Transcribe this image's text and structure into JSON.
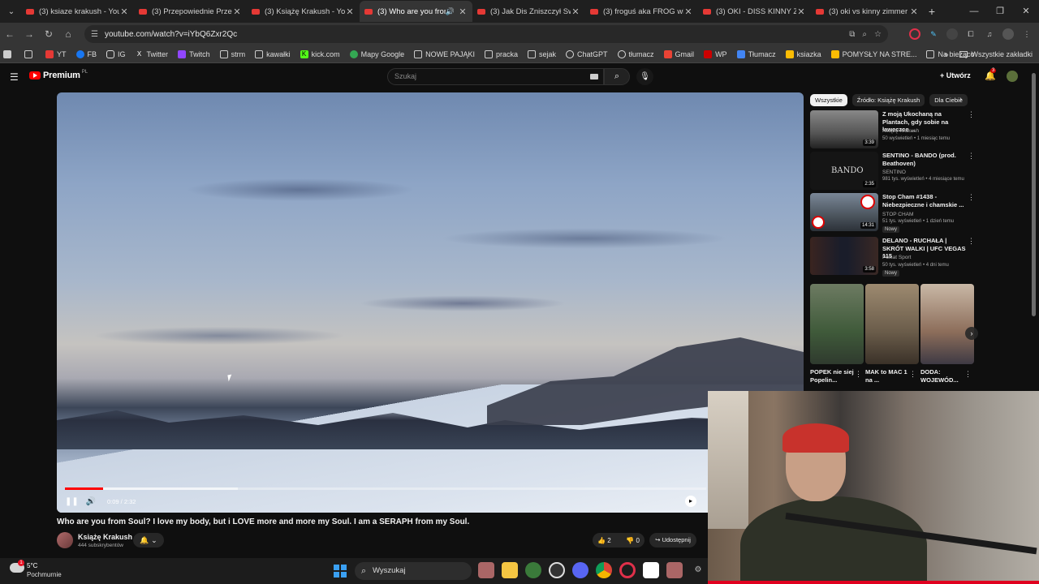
{
  "browser": {
    "tabs": [
      {
        "title": "(3) ksiaze krakush - YouTube",
        "active": false
      },
      {
        "title": "(3) Przepowiednie Prześw...",
        "active": false
      },
      {
        "title": "(3) Książę Krakush - YouTube",
        "active": false
      },
      {
        "title": "(3) Who are you from",
        "active": true
      },
      {
        "title": "(3) Jak Dis Zniszczył Swoje...",
        "active": false
      },
      {
        "title": "(3) froguś aka FROG wbije...",
        "active": false
      },
      {
        "title": "(3) OKI - DISS KINNY ZIMA...",
        "active": false
      },
      {
        "title": "(3) oki vs kinny zimmer -",
        "active": false
      }
    ],
    "url": "youtube.com/watch?v=iYbQ6Zxr2Qc",
    "bookmarks": [
      "YT",
      "FB",
      "IG",
      "Twitter",
      "Twitch",
      "strm",
      "kawałki",
      "kick.com",
      "Mapy Google",
      "NOWE PAJĄKI",
      "pracka",
      "sejak",
      "ChatGPT",
      "tłumacz",
      "Gmail",
      "WP",
      "Tłumacz",
      "ksiazka",
      "POMYSŁY NA STRE...",
      "Na bieżąco"
    ],
    "bookmarks_all": "Wszystkie zakładki"
  },
  "youtube": {
    "logo": "Premium",
    "logo_country": "PL",
    "search_placeholder": "Szukaj",
    "create_label": "Utwórz",
    "notif_count": "3",
    "video": {
      "title": "Who are you from Soul? I love my body, but i LOVE more and more my Soul. I am a SERAPH from my Soul.",
      "time": "0:09 / 2:32",
      "progress_played": 0.059,
      "progress_loaded": 0.27,
      "channel": "Książę Krakush",
      "subscribers": "444 subskrybentów",
      "likes": "2",
      "dislikes": "0",
      "share": "Udostępnij"
    },
    "chips": [
      "Wszystkie",
      "Źródło: Książę Krakush",
      "Dla Ciebie"
    ],
    "recommended": [
      {
        "title": "Z moją Ukochaną na Plantach, gdy sobie na ławeczce ...",
        "channel": "Książę Krakush",
        "meta": "50 wyświetleń • 1 miesiąc temu",
        "duration": "3:39",
        "badge": ""
      },
      {
        "title": "SENTINO - BANDO (prod. Beathoven)",
        "channel": "SENTINO",
        "meta": "981 tys. wyświetleń • 4 miesiące temu",
        "duration": "2:35",
        "badge": ""
      },
      {
        "title": "Stop Cham #1438 - Niebezpieczne i chamskie ...",
        "channel": "STOP CHAM",
        "meta": "51 tys. wyświetleń • 1 dzień temu",
        "duration": "14:31",
        "badge": "Nowy"
      },
      {
        "title": "DELANO - RUCHAŁA | SKRÓT WALKI | UFC VEGAS 115",
        "channel": "Polsat Sport",
        "meta": "50 tys. wyświetleń • 4 dni temu",
        "duration": "3:58",
        "badge": "Nowy"
      }
    ],
    "thumb_text_bando": "BANDO",
    "shorts": [
      {
        "title": "POPEK nie siej Popelin..."
      },
      {
        "title": "MAK to MAC 1 na ..."
      },
      {
        "title": "DODA: WOJEWÓD..."
      }
    ]
  },
  "taskbar": {
    "temperature": "5°C",
    "weather": "Pochmurnie",
    "weather_badge": "1",
    "search_label": "Wyszukaj"
  }
}
